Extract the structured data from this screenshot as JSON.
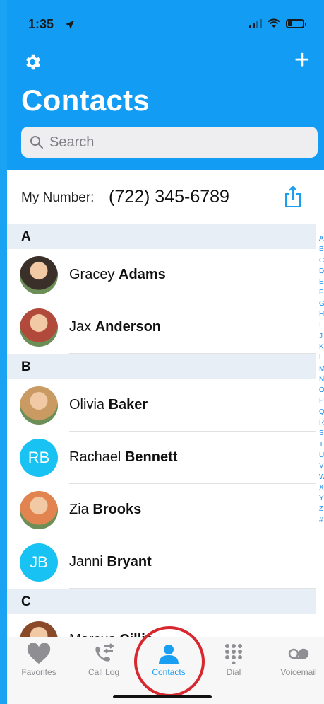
{
  "status": {
    "time": "1:35"
  },
  "header": {
    "title": "Contacts",
    "search_placeholder": "Search"
  },
  "my_number": {
    "label": "My Number:",
    "value": "(722) 345-6789"
  },
  "sections": [
    {
      "letter": "A",
      "contacts": [
        {
          "first": "Gracey",
          "last": "Adams",
          "avatar": "photo",
          "color": "#3b2f2a"
        },
        {
          "first": "Jax",
          "last": "Anderson",
          "avatar": "photo",
          "color": "#b14a3a"
        }
      ]
    },
    {
      "letter": "B",
      "contacts": [
        {
          "first": "Olivia",
          "last": "Baker",
          "avatar": "photo",
          "color": "#c99a62"
        },
        {
          "first": "Rachael",
          "last": "Bennett",
          "avatar": "initials",
          "initials": "RB"
        },
        {
          "first": "Zia",
          "last": "Brooks",
          "avatar": "photo",
          "color": "#e2844f"
        },
        {
          "first": "Janni",
          "last": "Bryant",
          "avatar": "initials",
          "initials": "JB"
        }
      ]
    },
    {
      "letter": "C",
      "contacts": [
        {
          "first": "Marcus",
          "last": "Cillic",
          "avatar": "photo",
          "color": "#8a4a2a"
        }
      ]
    }
  ],
  "index_letters": [
    "A",
    "B",
    "C",
    "D",
    "E",
    "F",
    "G",
    "H",
    "I",
    "J",
    "K",
    "L",
    "M",
    "N",
    "O",
    "P",
    "Q",
    "R",
    "S",
    "T",
    "U",
    "V",
    "W",
    "X",
    "Y",
    "Z",
    "#"
  ],
  "tabs": [
    {
      "label": "Favorites",
      "icon": "heart-icon",
      "active": false
    },
    {
      "label": "Call Log",
      "icon": "call-log-icon",
      "active": false
    },
    {
      "label": "Contacts",
      "icon": "person-icon",
      "active": true
    },
    {
      "label": "Dial",
      "icon": "keypad-icon",
      "active": false
    },
    {
      "label": "Voicemail",
      "icon": "voicemail-icon",
      "active": false
    }
  ],
  "colors": {
    "accent": "#129cf3",
    "initials_bg": "#18c3f3",
    "highlight": "#d7282f"
  }
}
